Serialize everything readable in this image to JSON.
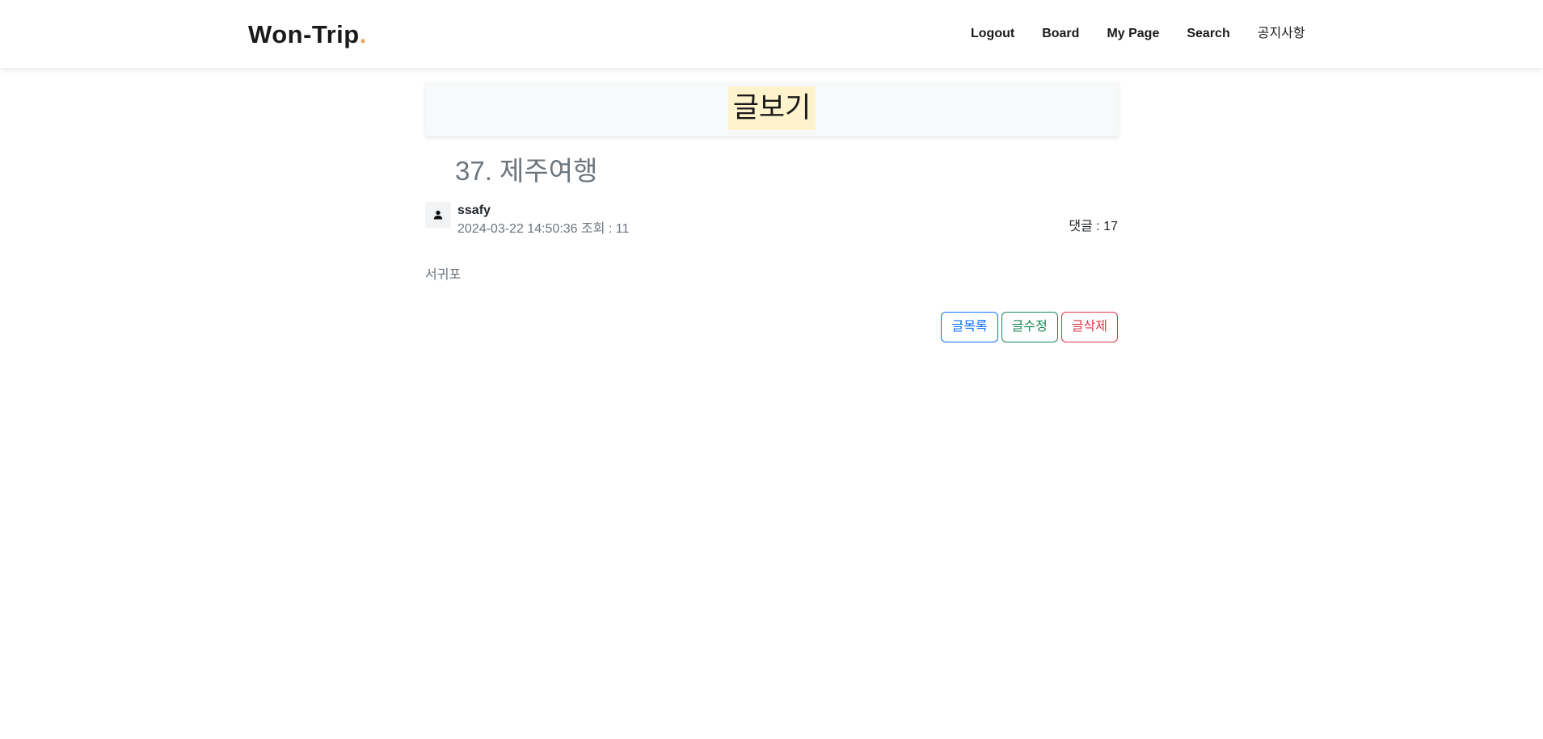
{
  "navbar": {
    "brand": "Won-Trip",
    "brand_dot": ".",
    "links": [
      "Logout",
      "Board",
      "My Page",
      "Search",
      "공지사항"
    ]
  },
  "header": {
    "title": "글보기"
  },
  "post": {
    "title": "37. 제주여행",
    "author": "ssafy",
    "meta": "2024-03-22 14:50:36 조회 : 11",
    "comments": "댓글 : 17",
    "content": "서귀포"
  },
  "actions": {
    "list_label": "글목록",
    "edit_label": "글수정",
    "delete_label": "글삭제"
  },
  "icons": {
    "avatar": "person-icon"
  },
  "colors": {
    "brand_dot": "#f0a35e",
    "header_highlight": "#fff3cd",
    "primary": "#0d6efd",
    "success": "#198754",
    "danger": "#dc3545"
  }
}
